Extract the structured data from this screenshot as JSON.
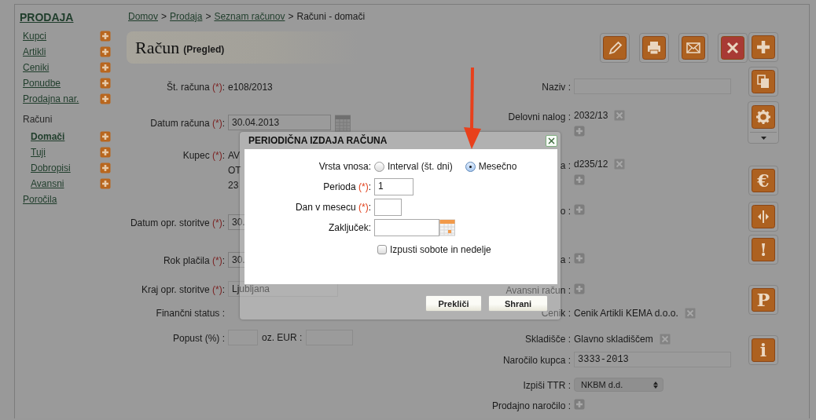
{
  "sidebar": {
    "title": "PRODAJA",
    "items": [
      {
        "label": "Kupci",
        "add": true,
        "selected": false
      },
      {
        "label": "Artikli",
        "add": true,
        "selected": false
      },
      {
        "label": "Ceniki",
        "add": true,
        "selected": false
      },
      {
        "label": "Ponudbe",
        "add": true,
        "selected": false
      },
      {
        "label": "Prodajna nar.",
        "add": true,
        "selected": false
      },
      {
        "label": "Računi",
        "add": false,
        "selected": false,
        "children": [
          {
            "label": "Domači",
            "add": true,
            "selected": true
          },
          {
            "label": "Tuji",
            "add": true,
            "selected": false
          },
          {
            "label": "Dobropisi",
            "add": true,
            "selected": false
          },
          {
            "label": "Avansni",
            "add": true,
            "selected": false
          }
        ]
      },
      {
        "label": "Poročila",
        "add": false,
        "selected": false
      }
    ]
  },
  "breadcrumb": [
    {
      "label": "Domov",
      "link": true
    },
    {
      "label": ">",
      "link": false
    },
    {
      "label": "Prodaja",
      "link": true
    },
    {
      "label": ">",
      "link": false
    },
    {
      "label": "Seznam računov",
      "link": true
    },
    {
      "label": ">",
      "link": false
    },
    {
      "label": "Računi - domači",
      "link": false
    }
  ],
  "page_title": {
    "title": "Račun",
    "subtitle": "(Pregled)"
  },
  "toolbar": [
    {
      "kind": "edit"
    },
    {
      "kind": "print"
    },
    {
      "kind": "email"
    },
    {
      "kind": "delete"
    }
  ],
  "side_toolbar": [
    {
      "kind": "add"
    },
    {
      "kind": "copy"
    },
    {
      "kind": "settings"
    },
    {
      "kind": "glyph",
      "glyph": "€"
    },
    {
      "kind": "split"
    },
    {
      "kind": "glyph",
      "glyph": "!"
    },
    {
      "kind": "glyph",
      "glyph": "P"
    },
    {
      "kind": "glyph",
      "glyph": "i"
    }
  ],
  "form": {
    "left": [
      {
        "kind": "text",
        "label": "Št. računa",
        "required": "(*)",
        "colon": ":",
        "value": "e108/2013"
      },
      {
        "kind": "date",
        "label": "Datum računa",
        "required": "(*)",
        "colon": ":",
        "value": "30.04.2013"
      },
      {
        "kind": "lines",
        "label": "Kupec",
        "required": "(*)",
        "colon": ":",
        "lines": [
          "AV",
          "OT",
          "23"
        ]
      },
      {
        "kind": "input",
        "label": "Datum opr. storitve",
        "required": "(*)",
        "colon": ":",
        "value": "30."
      },
      {
        "kind": "input",
        "label": "Rok plačila",
        "required": "(*)",
        "colon": ":",
        "value": "30."
      },
      {
        "kind": "input",
        "label": "Kraj opr. storitve",
        "required": "(*)",
        "colon": ":",
        "value": "Ljubljana"
      },
      {
        "kind": "text",
        "label": "Finančni status",
        "colon": ":"
      },
      {
        "kind": "pair",
        "label": "Popust (%)",
        "colon": ":",
        "second_label": "oz. EUR :"
      }
    ],
    "right": [
      {
        "kind": "input",
        "label": "Naziv",
        "colon": ":"
      },
      {
        "kind": "tags",
        "label": "Delovni nalog",
        "colon": ":",
        "tags": [
          "2032/13"
        ]
      },
      {
        "kind": "tags",
        "label": "a",
        "colon": ":",
        "tags": [
          "d235/12"
        ]
      },
      {
        "kind": "tags",
        "label": "o",
        "colon": ":"
      },
      {
        "kind": "tags",
        "label": "a",
        "colon": ":"
      },
      {
        "kind": "tags",
        "label": "Avansni račun",
        "colon": ":"
      },
      {
        "kind": "value",
        "label": "Cenik",
        "colon": ":",
        "value": "Cenik Artikli KEMA d.o.o."
      },
      {
        "kind": "value",
        "label": "Skladišče",
        "colon": ":",
        "value": "Glavno skladiščem"
      },
      {
        "kind": "input",
        "label": "Naročilo kupca",
        "colon": ":",
        "value": "3333-2013"
      },
      {
        "kind": "select",
        "label": "Izpiši TTR",
        "colon": ":",
        "value": "NKBM d.d."
      },
      {
        "kind": "tags",
        "label": "Prodajno naročilo",
        "colon": ":"
      }
    ]
  },
  "dialog": {
    "title": "PERIODIČNA IZDAJA RAČUNA",
    "fields": [
      {
        "kind": "radio",
        "label": "Vrsta vnosa:",
        "options": [
          {
            "label": "Interval (št. dni)",
            "selected": false
          },
          {
            "label": "Mesečno",
            "selected": true
          }
        ]
      },
      {
        "kind": "input",
        "label": "Perioda",
        "required": "(*)",
        "colon": ":",
        "value": "1"
      },
      {
        "kind": "input",
        "label": "Dan v mesecu",
        "required": "(*)",
        "colon": ":"
      },
      {
        "kind": "date",
        "label": "Zaključek:"
      },
      {
        "kind": "checkbox",
        "label": "Izpusti sobote in nedelje",
        "checked": false
      }
    ],
    "buttons": [
      "Prekliči",
      "Shrani"
    ]
  }
}
